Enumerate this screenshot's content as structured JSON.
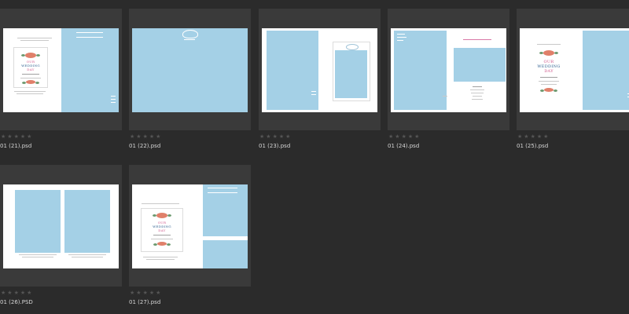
{
  "items": [
    {
      "filename": "01 (21).psd",
      "rating": 0
    },
    {
      "filename": "01 (22).psd",
      "rating": 0
    },
    {
      "filename": "01 (23).psd",
      "rating": 0
    },
    {
      "filename": "01 (24).psd",
      "rating": 0
    },
    {
      "filename": "01 (25).psd",
      "rating": 0
    },
    {
      "filename": "01 (26).PSD",
      "rating": 0
    },
    {
      "filename": "01 (27).psd",
      "rating": 0
    }
  ],
  "thumbs": {
    "t21": {
      "card_lines": [
        "OUR",
        "WEDDING",
        "DAY"
      ]
    },
    "t25": {
      "card_lines": [
        "OUR",
        "WEDDING",
        "DAY"
      ]
    },
    "t27": {
      "card_lines": [
        "OUR",
        "WEDDING",
        "DAY"
      ]
    }
  },
  "colors": {
    "background": "#2b2b2b",
    "tile": "#3a3a3a",
    "photo_placeholder": "#a4d0e6",
    "star_empty": "#555555",
    "label": "#d6d6d6"
  },
  "icons": {
    "rating": "star-outline-icon"
  }
}
